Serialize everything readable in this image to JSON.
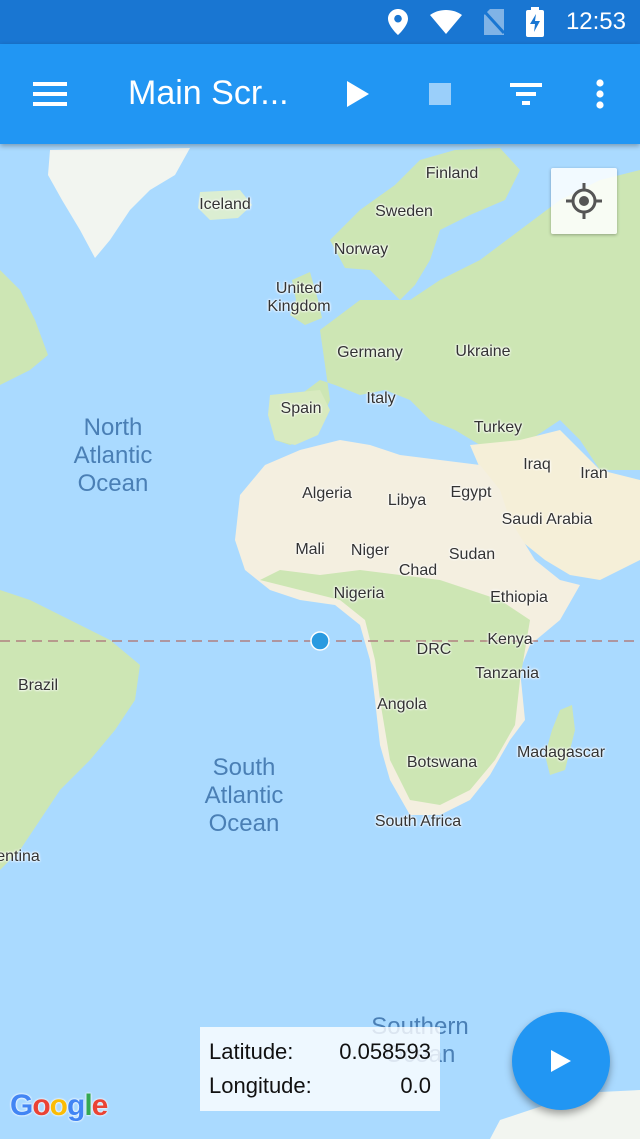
{
  "status_bar": {
    "time": "12:53",
    "icons": [
      "location-icon",
      "wifi-icon",
      "no-sim-icon",
      "battery-charging-icon"
    ]
  },
  "app_bar": {
    "title": "Main Scr...",
    "menu_icon": "menu-icon",
    "play_icon": "play-icon",
    "stop_icon": "stop-icon",
    "filter_icon": "filter-icon",
    "overflow_icon": "more-vert-icon"
  },
  "map": {
    "labels": {
      "finland": "Finland",
      "iceland": "Iceland",
      "sweden": "Sweden",
      "norway": "Norway",
      "united_kingdom_1": "United",
      "united_kingdom_2": "Kingdom",
      "germany": "Germany",
      "ukraine": "Ukraine",
      "spain": "Spain",
      "italy": "Italy",
      "turkey": "Turkey",
      "iraq": "Iraq",
      "iran": "Iran",
      "algeria": "Algeria",
      "libya": "Libya",
      "egypt": "Egypt",
      "saudi_arabia": "Saudi Arabia",
      "mali": "Mali",
      "niger": "Niger",
      "sudan": "Sudan",
      "chad": "Chad",
      "nigeria": "Nigeria",
      "ethiopia": "Ethiopia",
      "kenya": "Kenya",
      "drc": "DRC",
      "tanzania": "Tanzania",
      "brazil": "Brazil",
      "angola": "Angola",
      "madagascar": "Madagascar",
      "botswana": "Botswana",
      "south_africa": "South Africa",
      "argentina": "entina"
    },
    "oceans": {
      "north_atlantic": [
        "North",
        "Atlantic",
        "Ocean"
      ],
      "south_atlantic": [
        "South",
        "Atlantic",
        "Ocean"
      ],
      "southern": [
        "Southern",
        "Ocean"
      ]
    },
    "colors": {
      "water": "#aadaff",
      "land_green": "#cde6b4",
      "land_desert": "#f5f0e1",
      "marker": "#2a9ae0",
      "equator": "#b08080"
    },
    "locate_icon": "my-location-icon"
  },
  "coordinates": {
    "latitude_label": "Latitude:",
    "latitude_value": "0.058593",
    "longitude_label": "Longitude:",
    "longitude_value": "0.0"
  },
  "fab": {
    "icon": "play-icon"
  },
  "attribution": {
    "logo_letters": [
      "G",
      "o",
      "o",
      "g",
      "l",
      "e"
    ]
  }
}
